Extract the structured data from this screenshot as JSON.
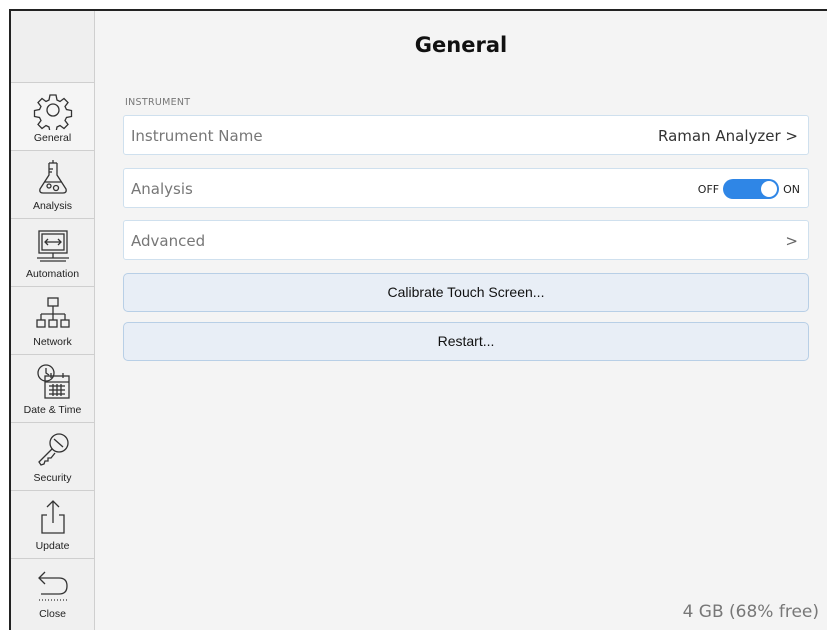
{
  "sidebar": {
    "items": [
      {
        "label": "General",
        "icon": "gear-icon",
        "active": true
      },
      {
        "label": "Analysis",
        "icon": "flask-icon",
        "active": false
      },
      {
        "label": "Automation",
        "icon": "monitor-arrows-icon",
        "active": false
      },
      {
        "label": "Network",
        "icon": "network-icon",
        "active": false
      },
      {
        "label": "Date & Time",
        "icon": "calendar-clock-icon",
        "active": false
      },
      {
        "label": "Security",
        "icon": "key-icon",
        "active": false
      },
      {
        "label": "Update",
        "icon": "upload-icon",
        "active": false
      },
      {
        "label": "Close",
        "icon": "back-arrow-icon",
        "active": false
      }
    ]
  },
  "main": {
    "title": "General",
    "section_header": "INSTRUMENT",
    "instrument_name": {
      "label": "Instrument Name",
      "value": "Raman Analyzer >"
    },
    "analysis": {
      "label": "Analysis",
      "off_label": "OFF",
      "on_label": "ON",
      "state": "on"
    },
    "advanced": {
      "label": "Advanced",
      "chevron": ">"
    },
    "calibrate_button": "Calibrate Touch Screen...",
    "restart_button": "Restart...",
    "storage": "4 GB (68% free)"
  },
  "colors": {
    "accent": "#2f86e6",
    "button_bg": "#e8eef6",
    "button_border": "#b8cfe6"
  }
}
